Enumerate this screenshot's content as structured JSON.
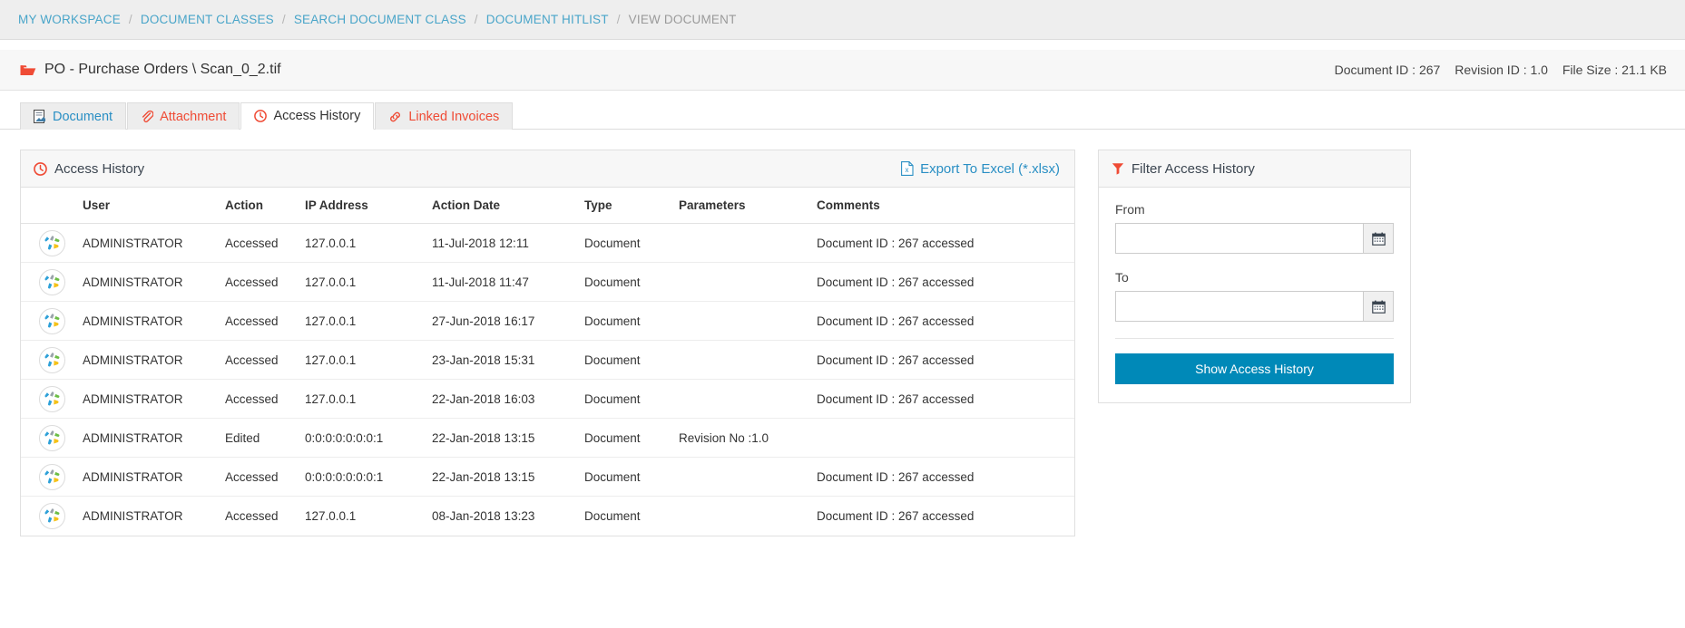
{
  "breadcrumb": {
    "items": [
      {
        "label": "MY WORKSPACE",
        "current": false
      },
      {
        "label": "DOCUMENT CLASSES",
        "current": false
      },
      {
        "label": "SEARCH DOCUMENT CLASS",
        "current": false
      },
      {
        "label": "DOCUMENT HITLIST",
        "current": false
      },
      {
        "label": "VIEW DOCUMENT",
        "current": true
      }
    ],
    "separator": "/"
  },
  "doc_header": {
    "folder_icon": "folder-open-icon",
    "title": "PO - Purchase Orders \\ Scan_0_2.tif",
    "document_id": "Document ID : 267",
    "revision_id": "Revision ID : 1.0",
    "file_size": "File Size : 21.1 KB"
  },
  "tabs": [
    {
      "label": "Document",
      "icon": "document-icon",
      "active": false,
      "style": "blue"
    },
    {
      "label": "Attachment",
      "icon": "paperclip-icon",
      "active": false,
      "style": "red"
    },
    {
      "label": "Access History",
      "icon": "clock-icon",
      "active": true,
      "style": "dark"
    },
    {
      "label": "Linked Invoices",
      "icon": "link-icon",
      "active": false,
      "style": "red"
    }
  ],
  "access_history": {
    "panel_title": "Access History",
    "panel_icon": "clock-icon",
    "export_label": "Export To Excel (*.xlsx)",
    "export_icon": "excel-file-icon",
    "columns": [
      "",
      "User",
      "Action",
      "IP Address",
      "Action Date",
      "Type",
      "Parameters",
      "Comments"
    ],
    "rows": [
      {
        "avatar": "user-avatar-icon",
        "user": "ADMINISTRATOR",
        "action": "Accessed",
        "ip": "127.0.0.1",
        "date": "11-Jul-2018 12:11",
        "type": "Document",
        "parameters": "",
        "comments": "Document ID : 267 accessed"
      },
      {
        "avatar": "user-avatar-icon",
        "user": "ADMINISTRATOR",
        "action": "Accessed",
        "ip": "127.0.0.1",
        "date": "11-Jul-2018 11:47",
        "type": "Document",
        "parameters": "",
        "comments": "Document ID : 267 accessed"
      },
      {
        "avatar": "user-avatar-icon",
        "user": "ADMINISTRATOR",
        "action": "Accessed",
        "ip": "127.0.0.1",
        "date": "27-Jun-2018 16:17",
        "type": "Document",
        "parameters": "",
        "comments": "Document ID : 267 accessed"
      },
      {
        "avatar": "user-avatar-icon",
        "user": "ADMINISTRATOR",
        "action": "Accessed",
        "ip": "127.0.0.1",
        "date": "23-Jan-2018 15:31",
        "type": "Document",
        "parameters": "",
        "comments": "Document ID : 267 accessed"
      },
      {
        "avatar": "user-avatar-icon",
        "user": "ADMINISTRATOR",
        "action": "Accessed",
        "ip": "127.0.0.1",
        "date": "22-Jan-2018 16:03",
        "type": "Document",
        "parameters": "",
        "comments": "Document ID : 267 accessed"
      },
      {
        "avatar": "user-avatar-icon",
        "user": "ADMINISTRATOR",
        "action": "Edited",
        "ip": "0:0:0:0:0:0:0:1",
        "date": "22-Jan-2018 13:15",
        "type": "Document",
        "parameters": "Revision No :1.0",
        "comments": ""
      },
      {
        "avatar": "user-avatar-icon",
        "user": "ADMINISTRATOR",
        "action": "Accessed",
        "ip": "0:0:0:0:0:0:0:1",
        "date": "22-Jan-2018 13:15",
        "type": "Document",
        "parameters": "",
        "comments": "Document ID : 267 accessed"
      },
      {
        "avatar": "user-avatar-icon",
        "user": "ADMINISTRATOR",
        "action": "Accessed",
        "ip": "127.0.0.1",
        "date": "08-Jan-2018 13:23",
        "type": "Document",
        "parameters": "",
        "comments": "Document ID : 267 accessed"
      }
    ]
  },
  "filter": {
    "panel_title": "Filter Access History",
    "panel_icon": "filter-icon",
    "from_label": "From",
    "from_value": "",
    "from_placeholder": "",
    "to_label": "To",
    "to_value": "",
    "to_placeholder": "",
    "calendar_icon": "calendar-icon",
    "submit_label": "Show Access History"
  },
  "colors": {
    "accent_blue": "#0089b8",
    "link_blue": "#2a8fc4",
    "breadcrumb_blue": "#49a5c9",
    "red": "#ef4b35",
    "panel_bg": "#f7f7f7",
    "border": "#e0e0e0"
  }
}
